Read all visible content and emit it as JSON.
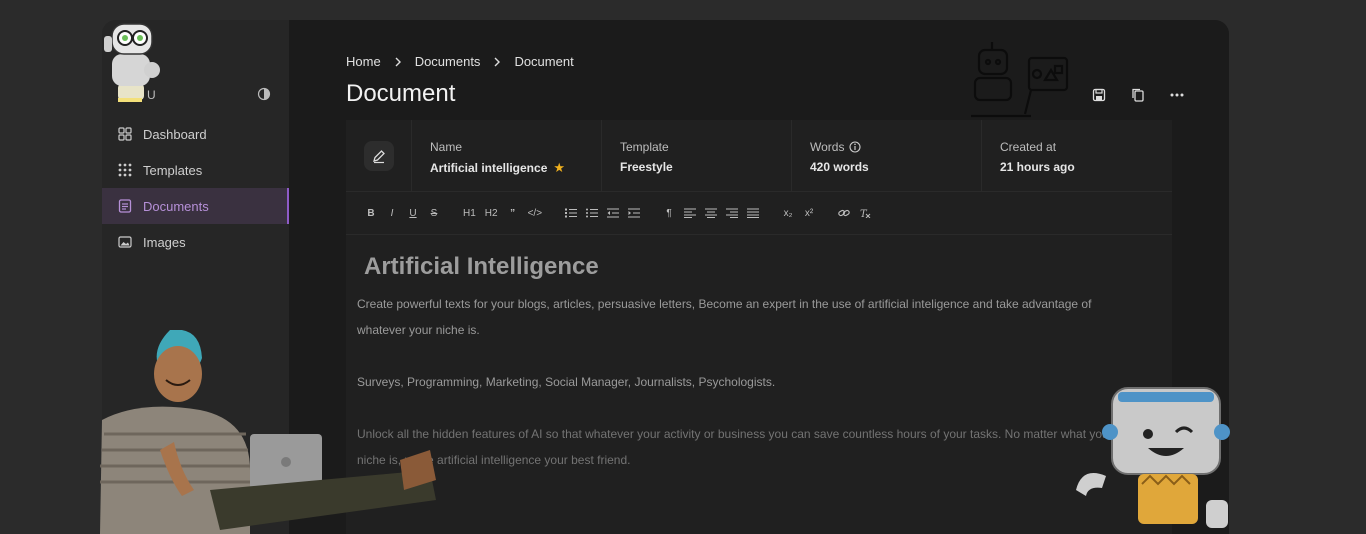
{
  "sidebar": {
    "user_initial": "U",
    "items": [
      {
        "label": "Dashboard",
        "icon": "grid-icon"
      },
      {
        "label": "Templates",
        "icon": "dots-grid-icon"
      },
      {
        "label": "Documents",
        "icon": "document-icon",
        "active": true
      },
      {
        "label": "Images",
        "icon": "image-icon"
      }
    ]
  },
  "breadcrumb": [
    "Home",
    "Documents",
    "Document"
  ],
  "page": {
    "title": "Document"
  },
  "meta": {
    "name_label": "Name",
    "name_value": "Artificial intelligence",
    "template_label": "Template",
    "template_value": "Freestyle",
    "words_label": "Words",
    "words_value": "420 words",
    "created_label": "Created at",
    "created_value": "21 hours ago"
  },
  "toolbar": [
    "B",
    "I",
    "U",
    "S",
    "H1",
    "H2",
    "”",
    "</>",
    "ol",
    "ul",
    "outdent",
    "indent",
    "¶",
    "align-left",
    "align-center",
    "align-right",
    "justify",
    "x₂",
    "x²",
    "link",
    "clear"
  ],
  "document": {
    "heading": "Artificial Intelligence",
    "paragraphs": [
      "Create powerful texts for your blogs, articles, persuasive letters, Become an expert in the use of artificial inteligence and take advantage of whatever your niche is.",
      "Surveys, Programming, Marketing, Social Manager, Journalists, Psychologists.",
      "Unlock all the hidden features of AI so that whatever your activity or business you can save countless hours of your tasks. No matter what your niche is, make artificial intelligence your best friend."
    ]
  },
  "colors": {
    "background": "#2b2b2b",
    "main": "#1b1b1b",
    "accent": "#8e5bc7",
    "star": "#f0b11e"
  }
}
